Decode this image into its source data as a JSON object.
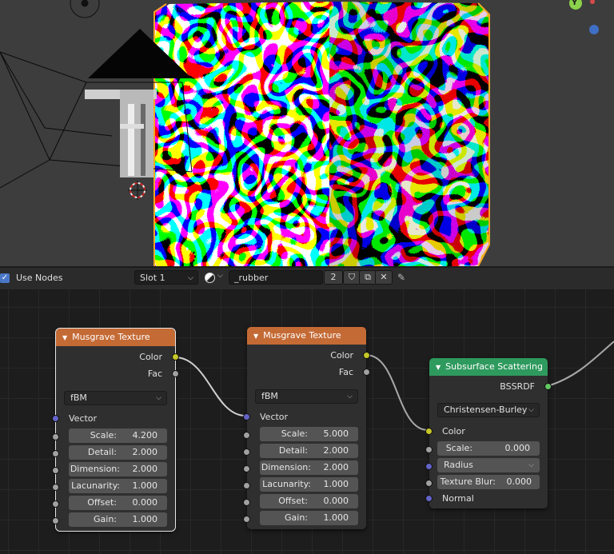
{
  "header": {
    "use_nodes_label": "Use Nodes",
    "slot_label": "Slot 1",
    "material_name": "_rubber",
    "user_count": "2"
  },
  "viewport": {
    "gizmo_axis_y": "Y",
    "colors": {
      "bg": "#3d3d3d",
      "selection": "#f5a623",
      "axis_y": "#8bd14b",
      "axis_z": "#3f6fc4"
    }
  },
  "nodes": {
    "musgrave1": {
      "title": "Musgrave Texture",
      "outputs": [
        "Color",
        "Fac"
      ],
      "dimensions": "fBM",
      "vector_label": "Vector",
      "fields": [
        {
          "label": "Scale:",
          "value": "4.200"
        },
        {
          "label": "Detail:",
          "value": "2.000"
        },
        {
          "label": "Dimension:",
          "value": "2.000"
        },
        {
          "label": "Lacunarity:",
          "value": "1.000"
        },
        {
          "label": "Offset:",
          "value": "0.000"
        },
        {
          "label": "Gain:",
          "value": "1.000"
        }
      ]
    },
    "musgrave2": {
      "title": "Musgrave Texture",
      "outputs": [
        "Color",
        "Fac"
      ],
      "dimensions": "fBM",
      "vector_label": "Vector",
      "fields": [
        {
          "label": "Scale:",
          "value": "5.000"
        },
        {
          "label": "Detail:",
          "value": "2.000"
        },
        {
          "label": "Dimension:",
          "value": "2.000"
        },
        {
          "label": "Lacunarity:",
          "value": "1.000"
        },
        {
          "label": "Offset:",
          "value": "0.000"
        },
        {
          "label": "Gain:",
          "value": "1.000"
        }
      ]
    },
    "sss": {
      "title": "Subsurface Scattering",
      "output": "BSSRDF",
      "falloff": "Christensen-Burley",
      "color_label": "Color",
      "scale": {
        "label": "Scale:",
        "value": "0.000"
      },
      "radius_label": "Radius",
      "texture_blur": {
        "label": "Texture Blur:",
        "value": "0.000"
      },
      "normal_label": "Normal"
    }
  },
  "colors": {
    "texture_header": "#c46a35",
    "shader_header": "#2f9a5e",
    "socket_color": "#c7c729",
    "socket_float": "#a1a1a1",
    "socket_vector": "#6363c7",
    "socket_shader": "#63c763"
  }
}
